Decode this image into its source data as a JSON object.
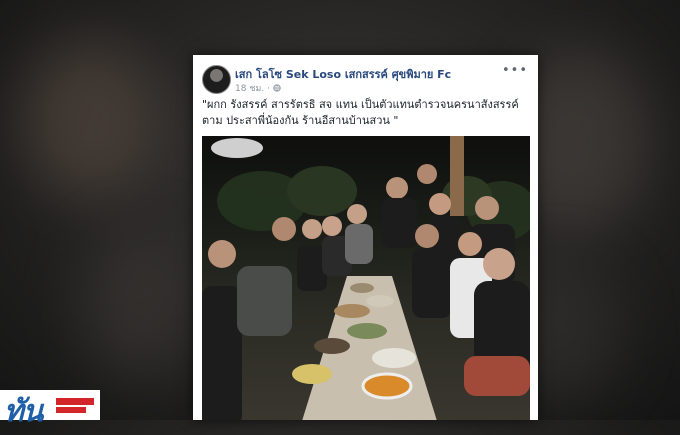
{
  "post": {
    "author": "เสก โลโซ Sek Loso เสกสรรค์ ศุขพิมาย Fc",
    "time": "18 ชม.",
    "privacy_icon": "globe-icon",
    "more": "•••",
    "text": "\"ผกก รังสรรค์ สารรัตรธิ สจ แทน เป็นตัวแทนตำรวจนครนาสังสรรค์ตาม ประสาพี่น้องกัน ร้านอีสานบ้านสวน \""
  },
  "photo": {
    "subject": "group-dinner-photo"
  },
  "channel_logo": {
    "icon": "channel-logo-icon"
  },
  "colors": {
    "author": "#29487d",
    "meta": "#8d949e",
    "logo_blue": "#1f5fa8",
    "logo_red": "#d3262b"
  }
}
